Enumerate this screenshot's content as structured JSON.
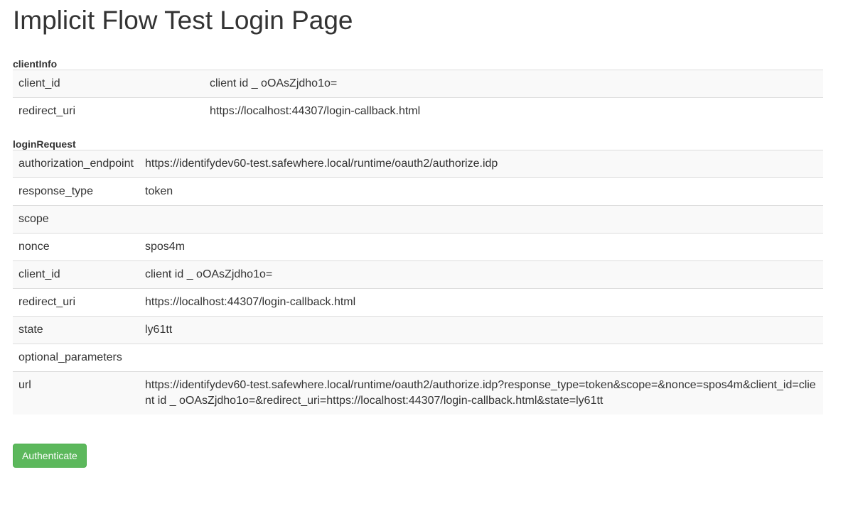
{
  "page": {
    "title": "Implicit Flow Test Login Page"
  },
  "clientInfo": {
    "label": "clientInfo",
    "rows": [
      {
        "key": "client_id",
        "value": "client id _ oOAsZjdho1o="
      },
      {
        "key": "redirect_uri",
        "value": "https://localhost:44307/login-callback.html"
      }
    ]
  },
  "loginRequest": {
    "label": "loginRequest",
    "rows": [
      {
        "key": "authorization_endpoint",
        "value": "https://identifydev60-test.safewhere.local/runtime/oauth2/authorize.idp"
      },
      {
        "key": "response_type",
        "value": "token"
      },
      {
        "key": "scope",
        "value": ""
      },
      {
        "key": "nonce",
        "value": "spos4m"
      },
      {
        "key": "client_id",
        "value": "client id _ oOAsZjdho1o="
      },
      {
        "key": "redirect_uri",
        "value": "https://localhost:44307/login-callback.html"
      },
      {
        "key": "state",
        "value": "ly61tt"
      },
      {
        "key": "optional_parameters",
        "value": ""
      },
      {
        "key": "url",
        "value": "https://identifydev60-test.safewhere.local/runtime/oauth2/authorize.idp?response_type=token&scope=&nonce=spos4m&client_id=client id _ oOAsZjdho1o=&redirect_uri=https://localhost:44307/login-callback.html&state=ly61tt"
      }
    ]
  },
  "actions": {
    "authenticate_label": "Authenticate"
  },
  "colors": {
    "button_bg": "#5cb85c",
    "stripe": "#f9f9f9",
    "border": "#dddddd"
  }
}
